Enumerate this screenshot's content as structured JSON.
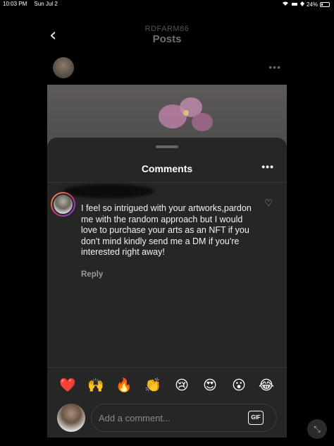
{
  "status_bar": {
    "time": "10:03 PM",
    "date": "Sun Jul 2",
    "battery": "24%",
    "icons": [
      "wifi-icon",
      "car-icon",
      "signal-icon",
      "battery-icon"
    ]
  },
  "header": {
    "username": "RDFARM86",
    "title": "Posts",
    "back_icon": "chevron-left-icon"
  },
  "post": {
    "more_icon": "ellipsis-icon"
  },
  "comments_sheet": {
    "title": "Comments",
    "more_icon": "ellipsis-icon",
    "comment": {
      "text": "I feel so intrigued with your artworks,pardon me with the random approach but I would love to purchase your arts as an NFT if you don't mind kindly send me a DM if you're interested right away!",
      "reply_label": "Reply",
      "like_icon": "heart-outline-icon"
    },
    "quick_reactions": [
      "❤️",
      "🙌",
      "🔥",
      "👏",
      "😢",
      "😍",
      "😮",
      "😂"
    ],
    "composer": {
      "placeholder": "Add a comment...",
      "gif_label": "GIF"
    }
  },
  "colors": {
    "background": "#000000",
    "sheet": "#262626",
    "text_secondary": "#9a9a9a",
    "avatar_ring": [
      "#f9a23a",
      "#d62e7a",
      "#7b3ff2"
    ]
  }
}
